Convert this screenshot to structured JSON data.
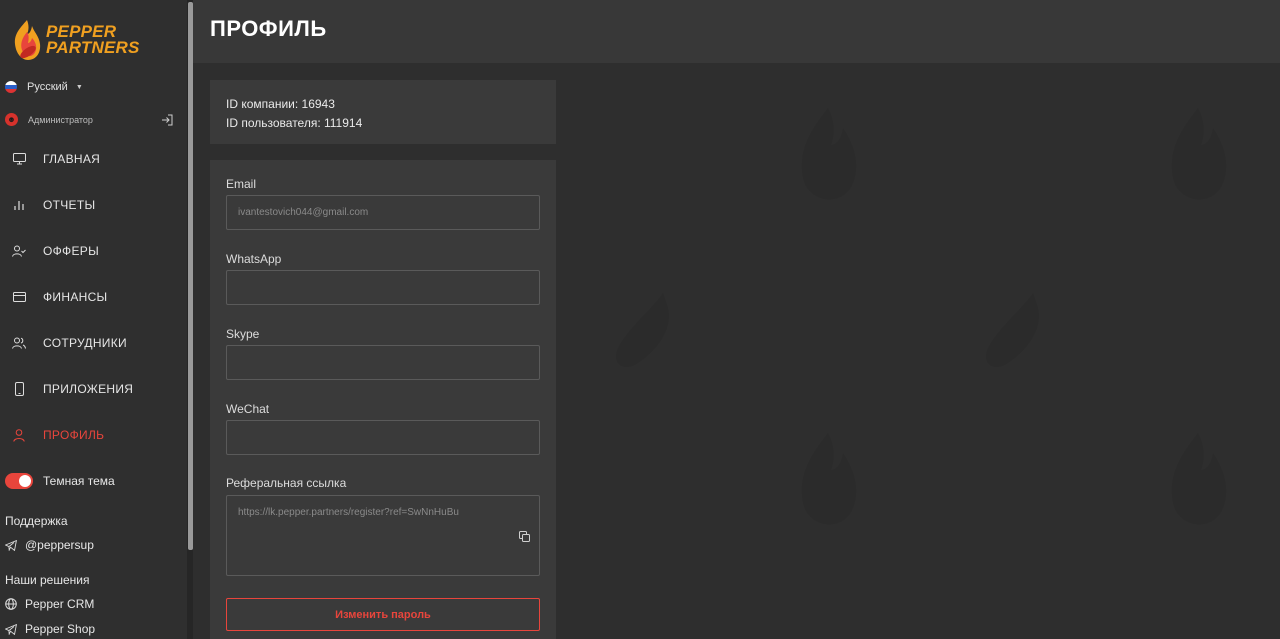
{
  "brand": {
    "line1": "PEPPER",
    "line2": "PARTNERS",
    "color": "#f0a020",
    "accent": "#e8453c"
  },
  "language": {
    "selected": "Русский"
  },
  "user": {
    "role": "Администратор"
  },
  "nav": [
    {
      "id": "main",
      "label": "ГЛАВНАЯ",
      "icon": "monitor-icon"
    },
    {
      "id": "reports",
      "label": "ОТЧЕТЫ",
      "icon": "bar-chart-icon"
    },
    {
      "id": "offers",
      "label": "ОФФЕРЫ",
      "icon": "user-check-icon"
    },
    {
      "id": "finance",
      "label": "ФИНАНСЫ",
      "icon": "credit-card-icon"
    },
    {
      "id": "staff",
      "label": "СОТРУДНИКИ",
      "icon": "users-icon"
    },
    {
      "id": "apps",
      "label": "ПРИЛОЖЕНИЯ",
      "icon": "phone-icon"
    },
    {
      "id": "profile",
      "label": "ПРОФИЛЬ",
      "icon": "user-icon",
      "active": true
    }
  ],
  "theme": {
    "label": "Темная тема",
    "enabled": true
  },
  "support": {
    "title": "Поддержка",
    "telegram": "@peppersup"
  },
  "solutions": {
    "title": "Наши решения",
    "items": [
      "Pepper CRM",
      "Pepper Shop"
    ]
  },
  "page": {
    "title": "ПРОФИЛЬ"
  },
  "ids": {
    "company": "ID компании: 16943",
    "user": "ID пользователя: 111914"
  },
  "form": {
    "email": {
      "label": "Email",
      "value": "ivantestovich044@gmail.com"
    },
    "whatsapp": {
      "label": "WhatsApp",
      "value": ""
    },
    "skype": {
      "label": "Skype",
      "value": ""
    },
    "wechat": {
      "label": "WeChat",
      "value": ""
    },
    "referral": {
      "label": "Реферальная ссылка",
      "value": "https://lk.pepper.partners/register?ref=SwNnHuBu"
    },
    "change_password": "Изменить пароль"
  }
}
